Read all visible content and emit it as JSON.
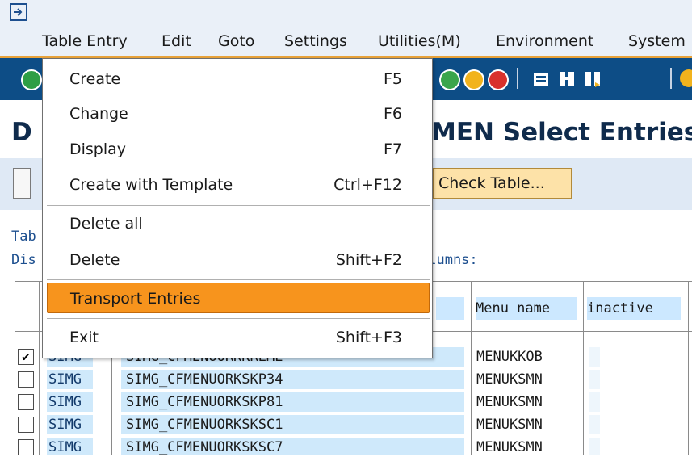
{
  "menubar": {
    "items": [
      "Table Entry",
      "Edit",
      "Goto",
      "Settings",
      "Utilities(M)",
      "Environment",
      "System"
    ]
  },
  "title": {
    "left_fragment": "D",
    "right_fragment": "MEN Select Entries"
  },
  "app_toolbar": {
    "check_table_label": "Check Table..."
  },
  "screen_text": {
    "line1_fragment": "Tab",
    "line2_fragment": "Dis",
    "line2_suffix": "olumns:"
  },
  "table": {
    "headers": [
      "Menu name",
      "inactive"
    ],
    "rows": [
      {
        "checked": true,
        "check_mark": "✔",
        "type": "SIMG",
        "name": "SIMG_CFMENUORKKREME",
        "menu": "MENUKKOB"
      },
      {
        "checked": false,
        "check_mark": "",
        "type": "SIMG",
        "name": "SIMG_CFMENUORKSKP34",
        "menu": "MENUKSMN"
      },
      {
        "checked": false,
        "check_mark": "",
        "type": "SIMG",
        "name": "SIMG_CFMENUORKSKP81",
        "menu": "MENUKSMN"
      },
      {
        "checked": false,
        "check_mark": "",
        "type": "SIMG",
        "name": "SIMG_CFMENUORKSKSC1",
        "menu": "MENUKSMN"
      },
      {
        "checked": false,
        "check_mark": "",
        "type": "SIMG",
        "name": "SIMG_CFMENUORKSKSC7",
        "menu": "MENUKSMN"
      }
    ]
  },
  "dropdown": {
    "items": [
      {
        "label": "Create",
        "shortcut": "F5",
        "highlighted": false
      },
      {
        "label": "Change",
        "shortcut": "F6",
        "highlighted": false
      },
      {
        "label": "Display",
        "shortcut": "F7",
        "highlighted": false
      },
      {
        "label": "Create with Template",
        "shortcut": "Ctrl+F12",
        "highlighted": false
      },
      {
        "label": "Delete all",
        "shortcut": "",
        "highlighted": false
      },
      {
        "label": "Delete",
        "shortcut": "Shift+F2",
        "highlighted": false
      },
      {
        "label": "Transport Entries",
        "shortcut": "",
        "highlighted": true
      },
      {
        "label": "Exit",
        "shortcut": "Shift+F3",
        "highlighted": false
      }
    ]
  },
  "colors": {
    "highlight": "#f7941d",
    "toolbar": "#0d4d86",
    "menubar_accent": "#e8a23a"
  }
}
